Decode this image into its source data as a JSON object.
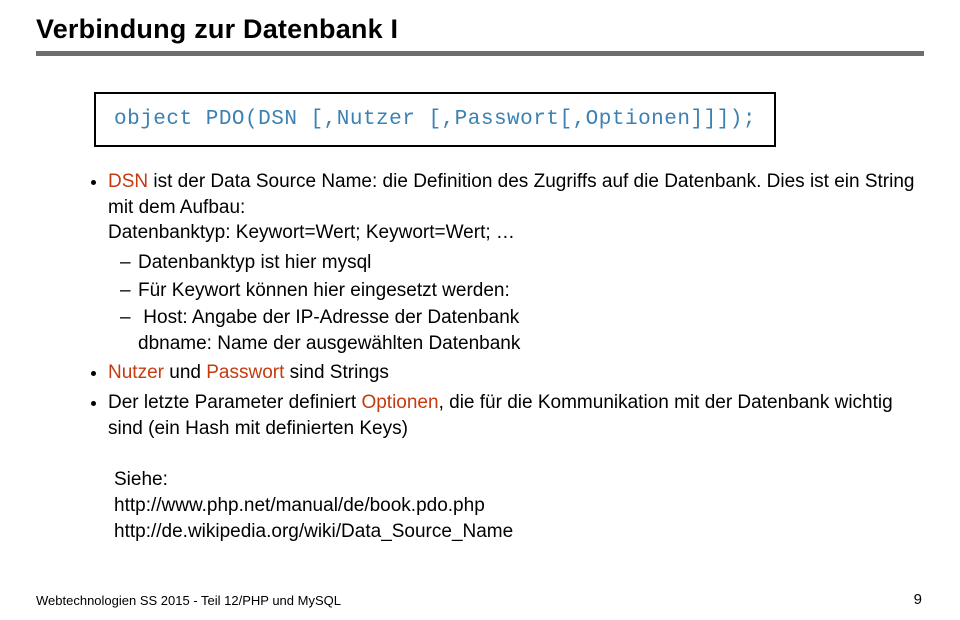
{
  "title": "Verbindung zur Datenbank I",
  "code_box": "object PDO(DSN [,Nutzer [,Passwort[,Optionen]]]);",
  "b1_pre": "DSN",
  "b1_rest": " ist der Data Source Name: die Definition des Zugriffs auf die Datenbank. Dies ist ein String mit dem Aufbau:",
  "b1_l2": "Datenbanktyp: Keywort=Wert; Keywort=Wert; …",
  "b1_sub1": "Datenbanktyp ist hier mysql",
  "b1_sub2": "Für Keywort können hier eingesetzt werden:",
  "b1_sub3": "Host: Angabe der IP-Adresse der Datenbank",
  "b1_sub3b": "dbname: Name der ausgewählten Datenbank",
  "b2_w1": "Nutzer",
  "b2_mid": " und ",
  "b2_w2": "Passwort",
  "b2_rest": " sind Strings",
  "b3_pre": "Der letzte Parameter definiert ",
  "b3_word": "Optionen",
  "b3_rest": ", die für die Kommunikation mit der Datenbank wichtig sind (ein Hash mit definierten Keys)",
  "see_label": "Siehe:",
  "link1": "http://www.php.net/manual/de/book.pdo.php",
  "link2": "http://de.wikipedia.org/wiki/Data_Source_Name",
  "footer": "Webtechnologien SS 2015 - Teil 12/PHP und MySQL",
  "page": "9"
}
